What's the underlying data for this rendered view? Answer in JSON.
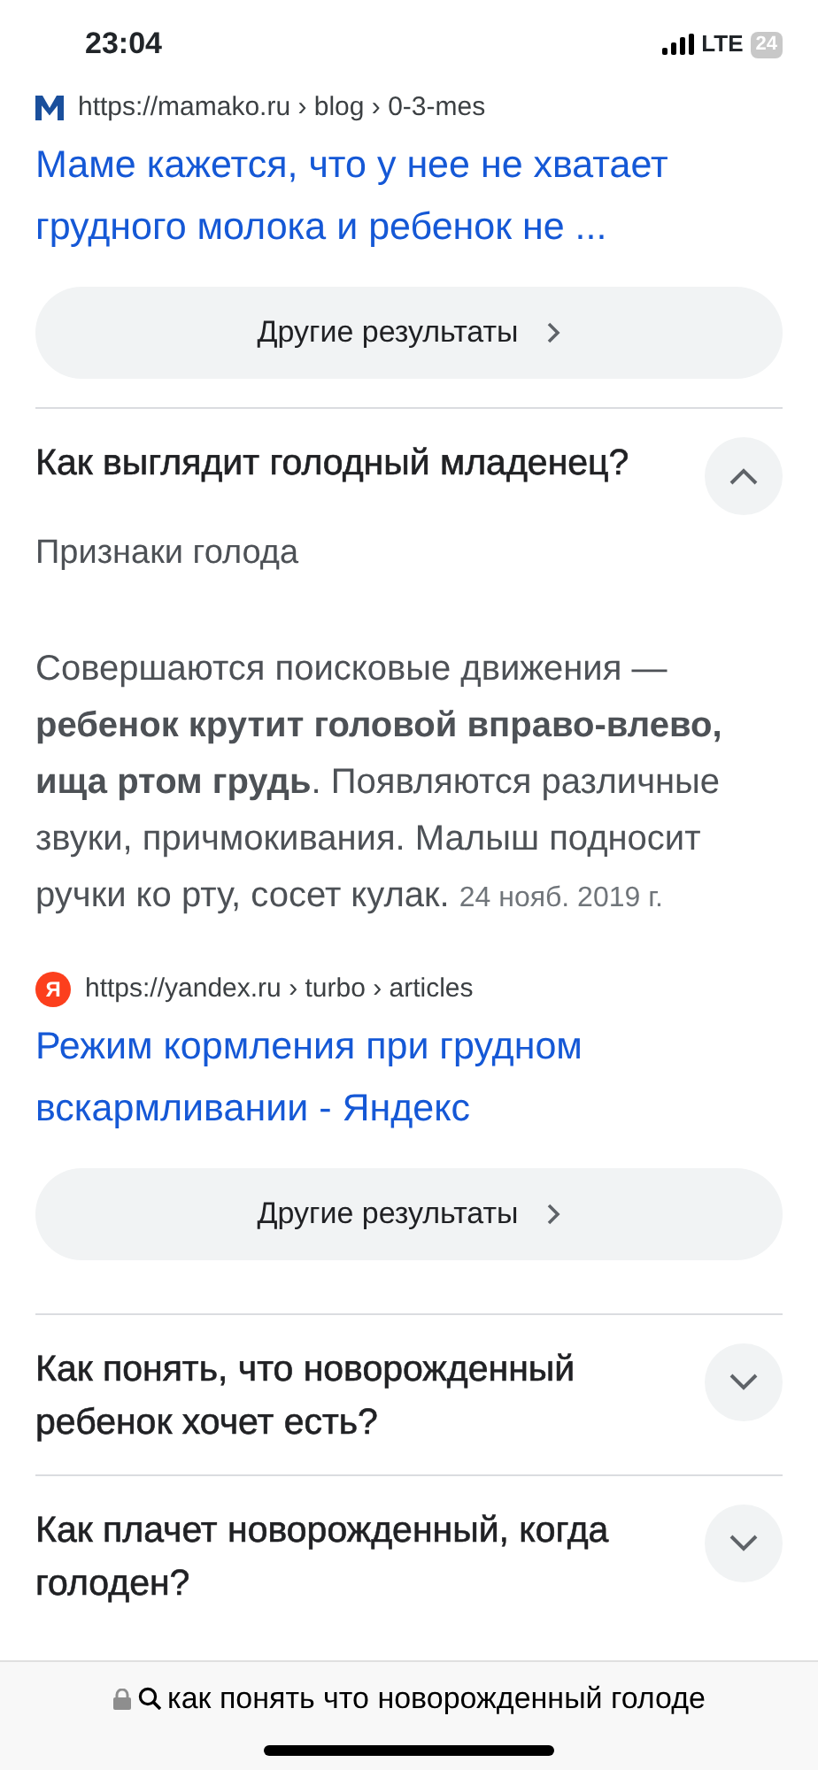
{
  "status_bar": {
    "time": "23:04",
    "network": "LTE",
    "battery": "24"
  },
  "results_top": {
    "url": "https://mamako.ru › blog › 0-3-mes",
    "title": "Маме кажется, что у нее не хватает грудного молока и ребенок не ...",
    "more_button": "Другие результаты"
  },
  "questions": [
    {
      "question": "Как выглядит голодный младенец?",
      "expanded": true,
      "answer_heading": "Признаки голода",
      "answer_text": "Совершаются поисковые движения — **ребенок крутит головой вправо-влево, ища ртом грудь**. Появляются различные звуки, причмокивания. Малыш подносит ручки ко рту, сосет кулак.",
      "date": "24 нояб. 2019 г.",
      "source_url": "https://yandex.ru › turbo › articles",
      "source_favicon": "Я",
      "source_title": "Режим кормления при грудном вскармливании - Яндекс",
      "more_button": "Другие результаты"
    },
    {
      "question": "Как понять, что новорожденный ребенок хочет есть?",
      "expanded": false
    },
    {
      "question": "Как плачет новорожденный, когда голоден?",
      "expanded": false
    }
  ],
  "address_bar": {
    "text": "как понять что новорожденный голоде"
  }
}
